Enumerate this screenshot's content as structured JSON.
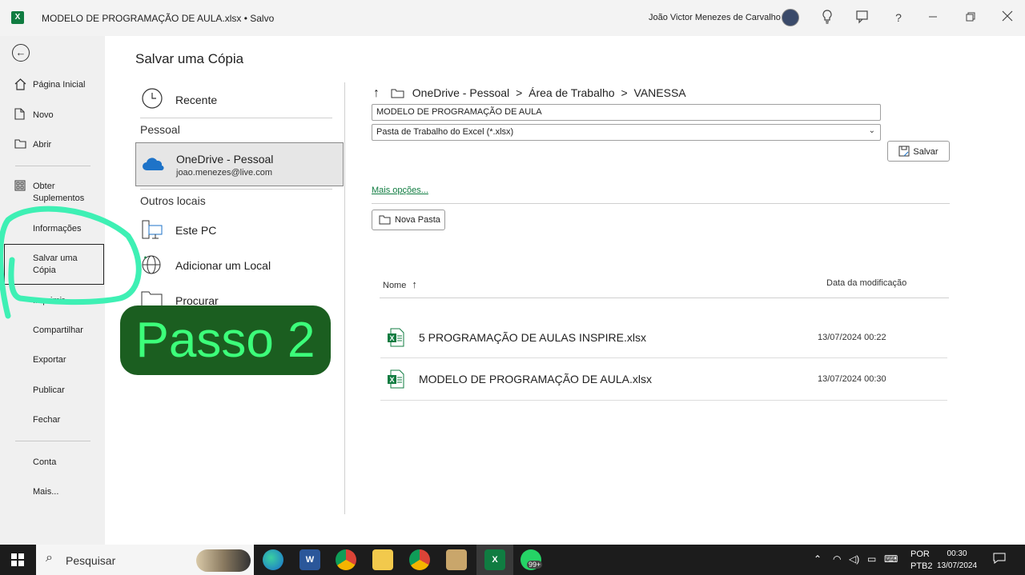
{
  "titlebar": {
    "logo": "X",
    "document_title": "MODELO DE PROGRAMAÇÃO DE AULA.xlsx  •  Salvo",
    "user_name": "João Victor Menezes de Carvalho"
  },
  "rail": {
    "items": [
      {
        "label": "Página Inicial",
        "icon": "home-icon"
      },
      {
        "label": "Novo",
        "icon": "new-document-icon"
      },
      {
        "label": "Abrir",
        "icon": "open-folder-icon"
      },
      {
        "label": "Obter Suplementos",
        "icon": "addins-icon"
      },
      {
        "label": "Informações"
      },
      {
        "label": "Salvar uma Cópia"
      },
      {
        "label": "Imprimir"
      },
      {
        "label": "Compartilhar"
      },
      {
        "label": "Exportar"
      },
      {
        "label": "Publicar"
      },
      {
        "label": "Fechar"
      },
      {
        "label": "Conta"
      },
      {
        "label": "Mais..."
      }
    ],
    "selected": "Salvar uma Cópia"
  },
  "main": {
    "title": "Salvar uma Cópia",
    "recent_label": "Recente",
    "personal_section": "Pessoal",
    "onedrive_name": "OneDrive - Pessoal",
    "onedrive_email": "joao.menezes@live.com",
    "other_section": "Outros locais",
    "this_pc": "Este PC",
    "add_location": "Adicionar um Local",
    "browse": "Procurar"
  },
  "savepane": {
    "breadcrumb": [
      "OneDrive - Pessoal",
      ">",
      "Área de Trabalho",
      ">",
      "VANESSA"
    ],
    "file_name_value": "MODELO DE PROGRAMAÇÃO DE AULA",
    "file_type_value": "Pasta de Trabalho do Excel (*.xlsx)",
    "save_label": "Salvar",
    "more_options": "Mais opções...",
    "new_folder": "Nova Pasta",
    "col_name": "Nome",
    "col_modified": "Data da modificação",
    "files": [
      {
        "name": "5 PROGRAMAÇÃO DE AULAS INSPIRE.xlsx",
        "modified": "13/07/2024 00:22"
      },
      {
        "name": "MODELO DE PROGRAMAÇÃO DE AULA.xlsx",
        "modified": "13/07/2024 00:30"
      }
    ]
  },
  "annotation": {
    "badge_text": "Passo 2",
    "badge_bg": "#1b5e20",
    "badge_fg": "#3cff7a",
    "stroke_color": "#3ef0b4"
  },
  "taskbar": {
    "search_placeholder": "Pesquisar",
    "whatsapp_badge": "99+",
    "lang_top": "POR",
    "lang_bottom": "PTB2",
    "time": "00:30",
    "date": "13/07/2024"
  },
  "colors": {
    "excel_green": "#107c41",
    "rail_bg": "#f0f0f0"
  }
}
